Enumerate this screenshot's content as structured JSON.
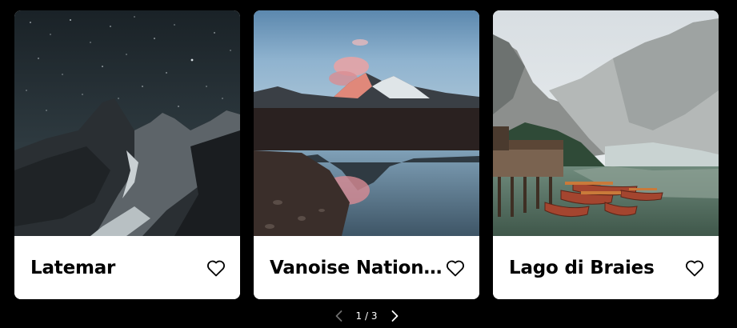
{
  "cards": [
    {
      "title": "Latemar",
      "image": "starry-night-mountain-photo",
      "favorite_icon": "heart-outline-icon"
    },
    {
      "title": "Vanoise Nationa...",
      "image": "alpine-lake-reflection-photo",
      "favorite_icon": "heart-outline-icon"
    },
    {
      "title": "Lago di Braies",
      "image": "lake-boats-dock-photo",
      "favorite_icon": "heart-outline-icon"
    }
  ],
  "pagination": {
    "label": "1 / 3",
    "prev_icon": "chevron-left-icon",
    "next_icon": "chevron-right-icon"
  },
  "colors": {
    "background": "#000000",
    "card": "#ffffff",
    "text": "#000000",
    "pager_text": "#ffffff",
    "pager_disabled": "#777777"
  }
}
